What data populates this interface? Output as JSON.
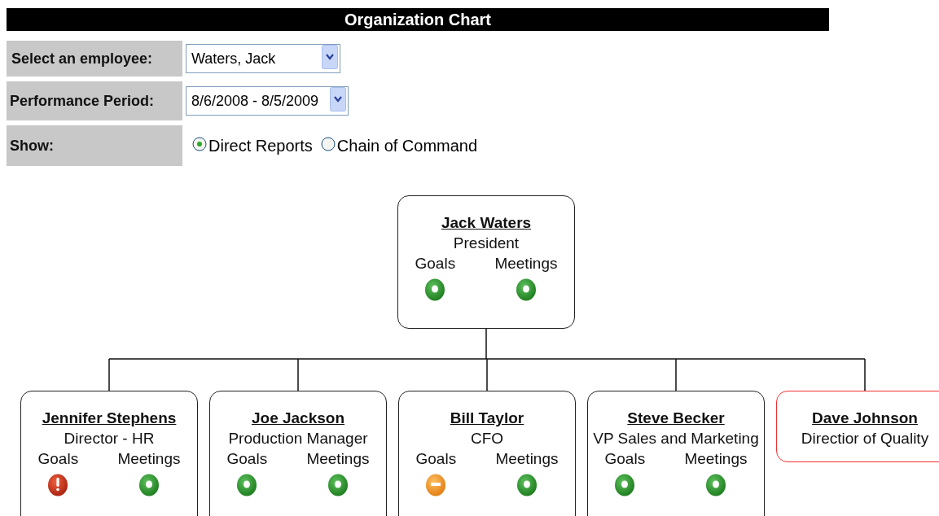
{
  "title": "Organization Chart",
  "form": {
    "employee": {
      "label": "Select an employee:",
      "value": "Waters, Jack"
    },
    "period": {
      "label": "Performance Period:",
      "value": "8/6/2008 - 8/5/2009"
    },
    "show": {
      "label": "Show:",
      "options": [
        {
          "label": "Direct Reports",
          "selected": true
        },
        {
          "label": "Chain of Command",
          "selected": false
        }
      ]
    }
  },
  "org_chart": {
    "root": {
      "name": "Jack Waters",
      "title": "President",
      "flagged": false,
      "metrics": [
        {
          "label": "Goals",
          "kind": "ok"
        },
        {
          "label": "Meetings",
          "kind": "ok"
        }
      ]
    },
    "children": [
      {
        "name": "Jennifer Stephens",
        "title": "Director - HR",
        "flagged": false,
        "metrics": [
          {
            "label": "Goals",
            "kind": "alert"
          },
          {
            "label": "Meetings",
            "kind": "ok"
          }
        ]
      },
      {
        "name": "Joe Jackson",
        "title": "Production Manager",
        "flagged": false,
        "metrics": [
          {
            "label": "Goals",
            "kind": "ok"
          },
          {
            "label": "Meetings",
            "kind": "ok"
          }
        ]
      },
      {
        "name": "Bill Taylor",
        "title": "CFO",
        "flagged": false,
        "metrics": [
          {
            "label": "Goals",
            "kind": "warning"
          },
          {
            "label": "Meetings",
            "kind": "ok"
          }
        ]
      },
      {
        "name": "Steve Becker",
        "title": "VP Sales and Marketing",
        "flagged": false,
        "metrics": [
          {
            "label": "Goals",
            "kind": "ok"
          },
          {
            "label": "Meetings",
            "kind": "ok"
          }
        ]
      },
      {
        "name": "Dave Johnson",
        "title": "Directior of Quality",
        "flagged": true
      }
    ]
  }
}
